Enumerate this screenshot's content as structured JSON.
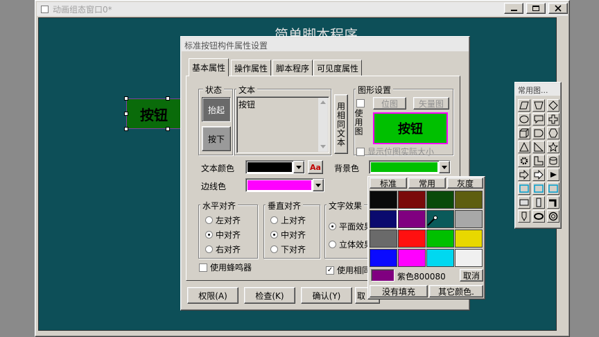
{
  "window": {
    "title": "动画组态窗口0*",
    "canvas_title": "简单脚本程序",
    "controls": [
      "minimize-icon",
      "maximize-icon",
      "close-icon"
    ]
  },
  "canvas_button": {
    "label": "按钮",
    "bg": "#0a6b0a"
  },
  "palette": {
    "title": "常用图...",
    "icons": [
      "parallelogram-icon",
      "trapezoid-icon",
      "diamond-icon",
      "ellipse-icon",
      "callout-icon",
      "cross-icon",
      "cube-icon",
      "delay-shape-icon",
      "hexagon-icon",
      "triangle-icon",
      "right-triangle-icon",
      "star-icon",
      "gear-icon",
      "l-shape-icon",
      "cylinder-icon",
      "arrow-right-icon",
      "arrow-outline-icon",
      "play-icon",
      "rectangle-cyan-icon",
      "rectangle-cyan-icon",
      "rectangle-cyan-icon",
      "panel-icon",
      "column-icon",
      "corner-icon",
      "pin-icon",
      "oval-icon",
      "ring-icon"
    ]
  },
  "dialog": {
    "title": "标准按钮构件属性设置",
    "tabs": [
      "基本属性",
      "操作属性",
      "脚本程序",
      "可见度属性"
    ],
    "state_group": {
      "label": "状态",
      "up": "抬起",
      "down": "按下"
    },
    "text_group": {
      "label": "文本",
      "value": "按钮",
      "same_text_button": "用相同文本"
    },
    "graphic_group": {
      "label": "图形设置",
      "use_image": "使用图",
      "bitmap_button": "位图",
      "vector_button": "矢量图",
      "preview_label": "按钮",
      "preview_bg": "#00c000",
      "show_actual_size": "显示位图实际大小"
    },
    "text_color": {
      "label": "文本颜色",
      "value": "#000000",
      "font_btn": "Aa"
    },
    "border_color": {
      "label": "边线色",
      "value": "#ff00ff"
    },
    "bg_color": {
      "label": "背景色",
      "value": "#00c000"
    },
    "h_align": {
      "label": "水平对齐",
      "options": [
        "左对齐",
        "中对齐",
        "右对齐"
      ],
      "selected": 1
    },
    "v_align": {
      "label": "垂直对齐",
      "options": [
        "上对齐",
        "中对齐",
        "下对齐"
      ],
      "selected": 1
    },
    "text_effect": {
      "label": "文字效果",
      "options": [
        "平面效果",
        "立体效果"
      ],
      "selected": 0
    },
    "use_buzzer": "使用蜂鸣器",
    "use_same": "使用相同",
    "footer": {
      "permission": "权限(A)",
      "check": "检查(K)",
      "confirm": "确认(Y)",
      "cancel": "取"
    }
  },
  "color_picker": {
    "tabs": [
      "标准",
      "常用",
      "灰度"
    ],
    "colors": [
      "#0a0a0a",
      "#7a0a0a",
      "#0a4a0a",
      "#5e5e10",
      "#0a0a6e",
      "#800080",
      "#0a5a5a",
      "#a8a8a8",
      "#6a6a6a",
      "#ff1010",
      "#00c000",
      "#e8d800",
      "#0a0aff",
      "#ff00ff",
      "#00d8f0",
      "#f0f0f0"
    ],
    "selected_index": 5,
    "selected_name": "紫色800080",
    "selected_color": "#800080",
    "cancel": "取消",
    "no_fill": "没有填充",
    "other_colors": "其它颜色."
  }
}
